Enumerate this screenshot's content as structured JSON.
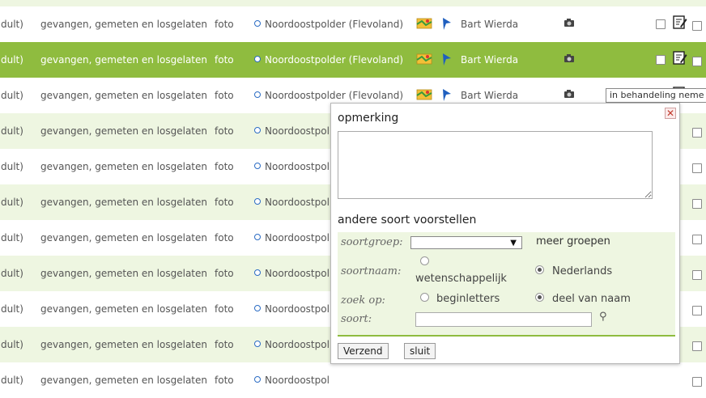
{
  "rows": [
    {
      "stage": "dult)",
      "action": "gevangen, gemeten en losgelaten",
      "media": "foto",
      "location": "Noordoostpolder (Flevoland)",
      "user": "Bart Wierda"
    },
    {
      "stage": "dult)",
      "action": "gevangen, gemeten en losgelaten",
      "media": "foto",
      "location": "Noordoostpolder (Flevoland)",
      "user": "Bart Wierda"
    },
    {
      "stage": "dult)",
      "action": "gevangen, gemeten en losgelaten",
      "media": "foto",
      "location": "Noordoostpolder (Flevoland)",
      "user": "Bart Wierda"
    },
    {
      "stage": "dult)",
      "action": "gevangen, gemeten en losgelaten",
      "media": "foto",
      "location": "Noordoostpol"
    },
    {
      "stage": "dult)",
      "action": "gevangen, gemeten en losgelaten",
      "media": "foto",
      "location": "Noordoostpol"
    },
    {
      "stage": "dult)",
      "action": "gevangen, gemeten en losgelaten",
      "media": "foto",
      "location": "Noordoostpol"
    },
    {
      "stage": "dult)",
      "action": "gevangen, gemeten en losgelaten",
      "media": "foto",
      "location": "Noordoostpol"
    },
    {
      "stage": "dult)",
      "action": "gevangen, gemeten en losgelaten",
      "media": "foto",
      "location": "Noordoostpol"
    },
    {
      "stage": "dult)",
      "action": "gevangen, gemeten en losgelaten",
      "media": "foto",
      "location": "Noordoostpol"
    },
    {
      "stage": "dult)",
      "action": "gevangen, gemeten en losgelaten",
      "media": "foto",
      "location": "Noordoostpol"
    },
    {
      "stage": "dult)",
      "action": "gevangen, gemeten en losgelaten",
      "media": "foto",
      "location": "Noordoostpol"
    }
  ],
  "tooltip": "in behandeling neme",
  "popup": {
    "title": "opmerking",
    "comment_value": "",
    "suggest_title": "andere soort voorstellen",
    "soortgroep_label": "soortgroep:",
    "soortgroep_value": "",
    "more_groups": "meer groepen",
    "soortnaam_label": "soortnaam:",
    "opt_scientific": "wetenschappelijk",
    "opt_dutch": "Nederlands",
    "zoek_label": "zoek op:",
    "opt_begin": "beginletters",
    "opt_part": "deel van naam",
    "soort_label": "soort:",
    "soort_value": "",
    "submit": "Verzend",
    "close": "sluit"
  },
  "colors": {
    "highlight": "#8fbc3f",
    "alt_row": "#eef6e1"
  }
}
